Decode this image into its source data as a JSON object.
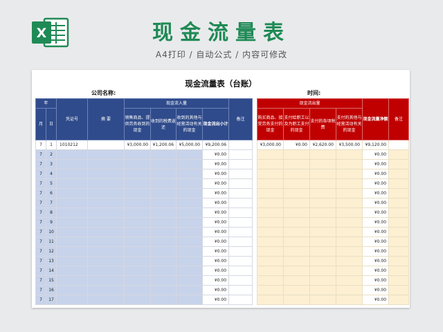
{
  "header": {
    "title": "现金流量表",
    "subtitle": "A4打印 / 自动公式 / 内容可修改"
  },
  "sheet": {
    "title": "现金流量表（台账）",
    "company_label": "公司名称:",
    "time_label": "时间:",
    "left_headers": {
      "year": "年",
      "month": "月",
      "day": "日",
      "voucher": "凭证号",
      "summary": "摘 要",
      "inflow_group": "现金流入量",
      "inflow_cols": [
        "销售商品、提供劳务收到的现金",
        "收到的税费返还",
        "收到的其他与经营活动有关的现金"
      ],
      "inflow_subtotal": "现金流出小计",
      "note": "备注"
    },
    "right_headers": {
      "outflow_group": "现金流出量",
      "outflow_cols": [
        "购买商品、接受劳务支付的现金",
        "支付给职工以及为职工支付的现金",
        "支付的各项税费",
        "支付的其他与经营活动有关的现金"
      ],
      "net": "现金流量净额",
      "note": "备注"
    },
    "rows": [
      {
        "month": "7",
        "day": "1",
        "voucher": "1010212",
        "in1": "¥3,000.00",
        "in2": "¥1,200.06",
        "in3": "¥5,000.00",
        "in_total": "¥9,200.06",
        "out1": "¥3,000.00",
        "out2": "¥0.00",
        "out3": "¥2,620.00",
        "out4": "¥3,500.00",
        "net": "¥9,120.00"
      },
      {
        "month": "7",
        "day": "2",
        "in_total": "¥0.00",
        "net": "¥0.00"
      },
      {
        "month": "7",
        "day": "3",
        "in_total": "¥0.00",
        "net": "¥0.00"
      },
      {
        "month": "7",
        "day": "4",
        "in_total": "¥0.00",
        "net": "¥0.00"
      },
      {
        "month": "7",
        "day": "5",
        "in_total": "¥0.00",
        "net": "¥0.00"
      },
      {
        "month": "7",
        "day": "6",
        "in_total": "¥0.00",
        "net": "¥0.00"
      },
      {
        "month": "7",
        "day": "7",
        "in_total": "¥0.00",
        "net": "¥0.00"
      },
      {
        "month": "7",
        "day": "8",
        "in_total": "¥0.00",
        "net": "¥0.00"
      },
      {
        "month": "7",
        "day": "9",
        "in_total": "¥0.00",
        "net": "¥0.00"
      },
      {
        "month": "7",
        "day": "10",
        "in_total": "¥0.00",
        "net": "¥0.00"
      },
      {
        "month": "7",
        "day": "11",
        "in_total": "¥0.00",
        "net": "¥0.00"
      },
      {
        "month": "7",
        "day": "12",
        "in_total": "¥0.00",
        "net": "¥0.00"
      },
      {
        "month": "7",
        "day": "13",
        "in_total": "¥0.00",
        "net": "¥0.00"
      },
      {
        "month": "7",
        "day": "14",
        "in_total": "¥0.00",
        "net": "¥0.00"
      },
      {
        "month": "7",
        "day": "15",
        "in_total": "¥0.00",
        "net": "¥0.00"
      },
      {
        "month": "7",
        "day": "16",
        "in_total": "¥0.00",
        "net": "¥0.00"
      },
      {
        "month": "7",
        "day": "17",
        "in_total": "¥0.00",
        "net": "¥0.00"
      }
    ]
  },
  "colors": {
    "brand_green": "#1f8a55",
    "header_blue": "#2f4b8b",
    "header_red": "#c00000",
    "row_blue": "#c7d3ea",
    "row_cream": "#fcefd2"
  },
  "icons": {
    "logo": "excel-icon"
  }
}
